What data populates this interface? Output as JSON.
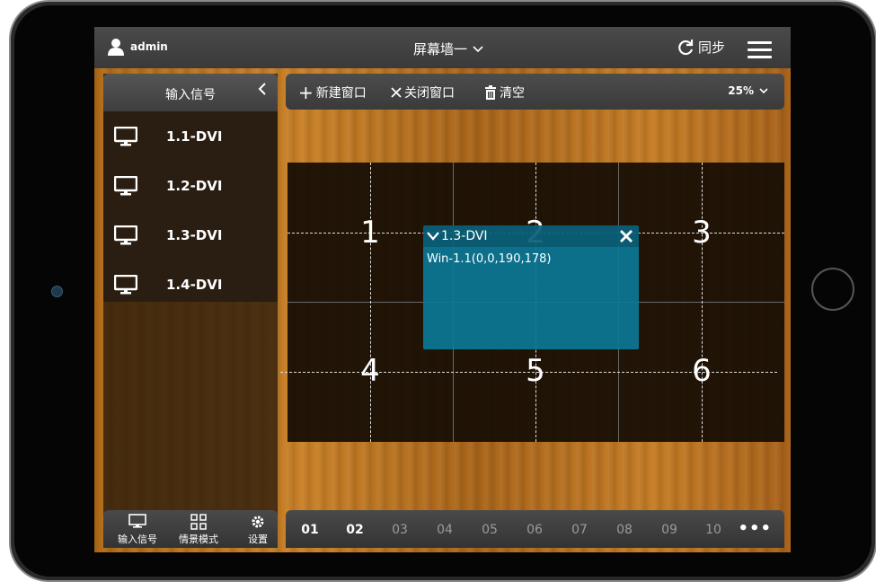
{
  "topbar": {
    "user": "admin",
    "wall_name": "屏幕墙一",
    "sync_label": "同步"
  },
  "sidebar": {
    "header": "输入信号",
    "items": [
      {
        "label": "1.1-DVI"
      },
      {
        "label": "1.2-DVI"
      },
      {
        "label": "1.3-DVI"
      },
      {
        "label": "1.4-DVI"
      }
    ],
    "footer": [
      {
        "label": "输入信号",
        "icon": "monitor-icon"
      },
      {
        "label": "情景模式",
        "icon": "grid-icon"
      },
      {
        "label": "设置",
        "icon": "gear-icon"
      }
    ]
  },
  "toolbar": {
    "new_window": "新建窗口",
    "close_window": "关闭窗口",
    "clear": "清空",
    "zoom": "25%"
  },
  "grid": {
    "cells": [
      "1",
      "2",
      "3",
      "4",
      "5",
      "6"
    ]
  },
  "window": {
    "title": "1.3-DVI",
    "info": "Win-1.1(0,0,190,178)"
  },
  "pager": {
    "pages": [
      "01",
      "02",
      "03",
      "04",
      "05",
      "06",
      "07",
      "08",
      "09",
      "10"
    ],
    "active": [
      "01",
      "02"
    ],
    "more": "•••"
  },
  "colors": {
    "window_bg": "#0c7896",
    "wood": "#c07a24"
  }
}
